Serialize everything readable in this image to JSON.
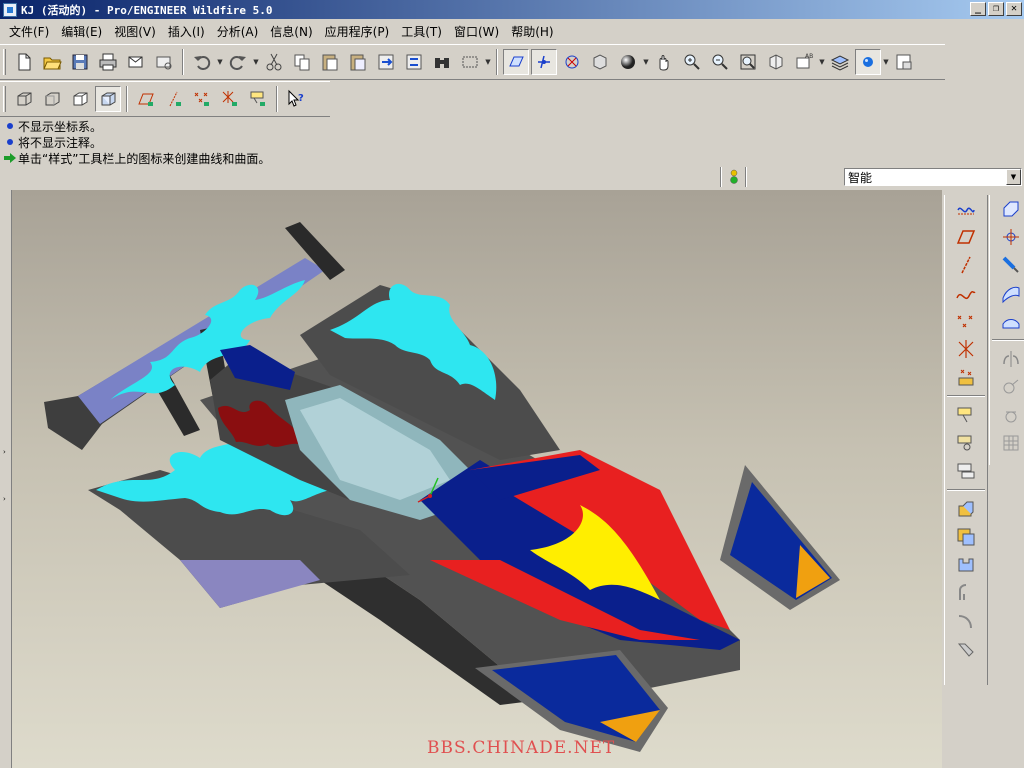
{
  "window": {
    "title": "KJ (活动的) - Pro/ENGINEER Wildfire 5.0",
    "controls": [
      "_",
      "❐",
      "✕"
    ]
  },
  "menu": [
    "文件(F)",
    "编辑(E)",
    "视图(V)",
    "插入(I)",
    "分析(A)",
    "信息(N)",
    "应用程序(P)",
    "工具(T)",
    "窗口(W)",
    "帮助(H)"
  ],
  "messages": [
    {
      "type": "info",
      "text": "不显示坐标系。"
    },
    {
      "type": "info",
      "text": "将不显示注释。"
    },
    {
      "type": "prompt",
      "text": "单击“样式”工具栏上的图标来创建曲线和曲面。"
    }
  ],
  "filter": {
    "selected": "智能"
  },
  "watermark": "BBS.CHINADE.NET",
  "colors": {
    "accent": "#0a246a",
    "car_body": "#4a4a4a",
    "flame": "#2ee6f0",
    "stripe_blue": "#0a1f8c",
    "stripe_red": "#e82020",
    "stripe_yellow": "#ffee00"
  }
}
